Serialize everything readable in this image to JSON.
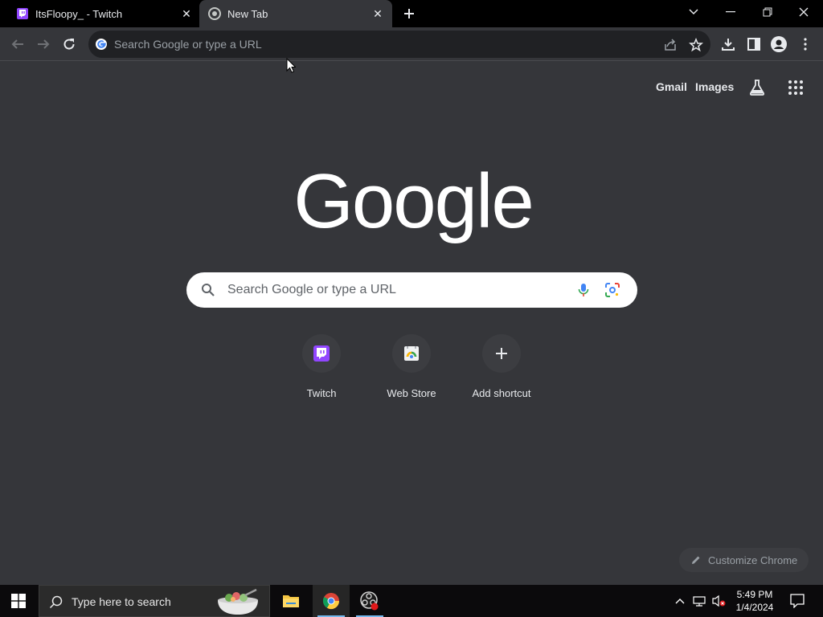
{
  "tabs": [
    {
      "title": "ItsFloopy_ - Twitch",
      "active": false
    },
    {
      "title": "New Tab",
      "active": true
    }
  ],
  "omnibox": {
    "placeholder": "Search Google or type a URL"
  },
  "top_links": {
    "gmail": "Gmail",
    "images": "Images"
  },
  "logo_text": "Google",
  "search": {
    "placeholder": "Search Google or type a URL"
  },
  "shortcuts": [
    {
      "label": "Twitch"
    },
    {
      "label": "Web Store"
    },
    {
      "label": "Add shortcut"
    }
  ],
  "customize_label": "Customize Chrome",
  "taskbar": {
    "search_placeholder": "Type here to search",
    "time": "5:49 PM",
    "date": "1/4/2024"
  },
  "colors": {
    "background": "#35363a",
    "tabstrip": "#000000",
    "twitch_purple": "#9146ff"
  }
}
